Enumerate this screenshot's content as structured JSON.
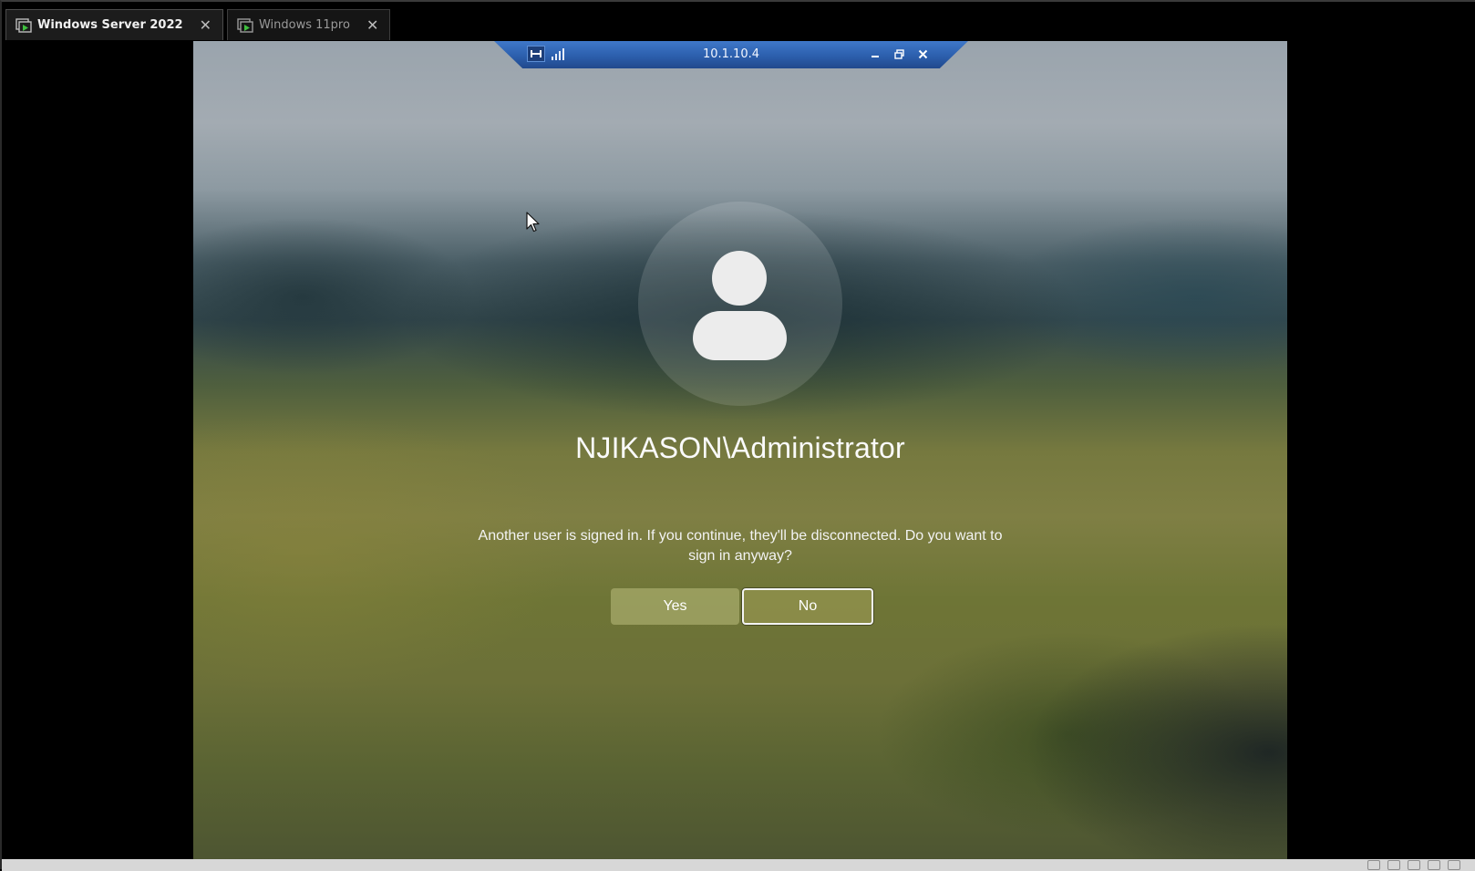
{
  "tabs": [
    {
      "label": "Windows Server 2022",
      "active": true,
      "icon": "vm-icon"
    },
    {
      "label": "Windows 11pro",
      "active": false,
      "icon": "vm-icon"
    }
  ],
  "rdp_bar": {
    "host": "10.1.10.4",
    "pin_icon": "pin-icon",
    "signal_icon": "signal-icon",
    "minimize_icon": "minimize-icon",
    "restore_icon": "restore-icon",
    "close_icon": "close-icon",
    "color": "#2c5fad"
  },
  "signin": {
    "username": "NJIKASON\\Administrator",
    "message": "Another user is signed in. If you continue, they'll be disconnected. Do you want to sign in anyway?",
    "yes_label": "Yes",
    "no_label": "No",
    "avatar_icon": "user-avatar-icon"
  }
}
